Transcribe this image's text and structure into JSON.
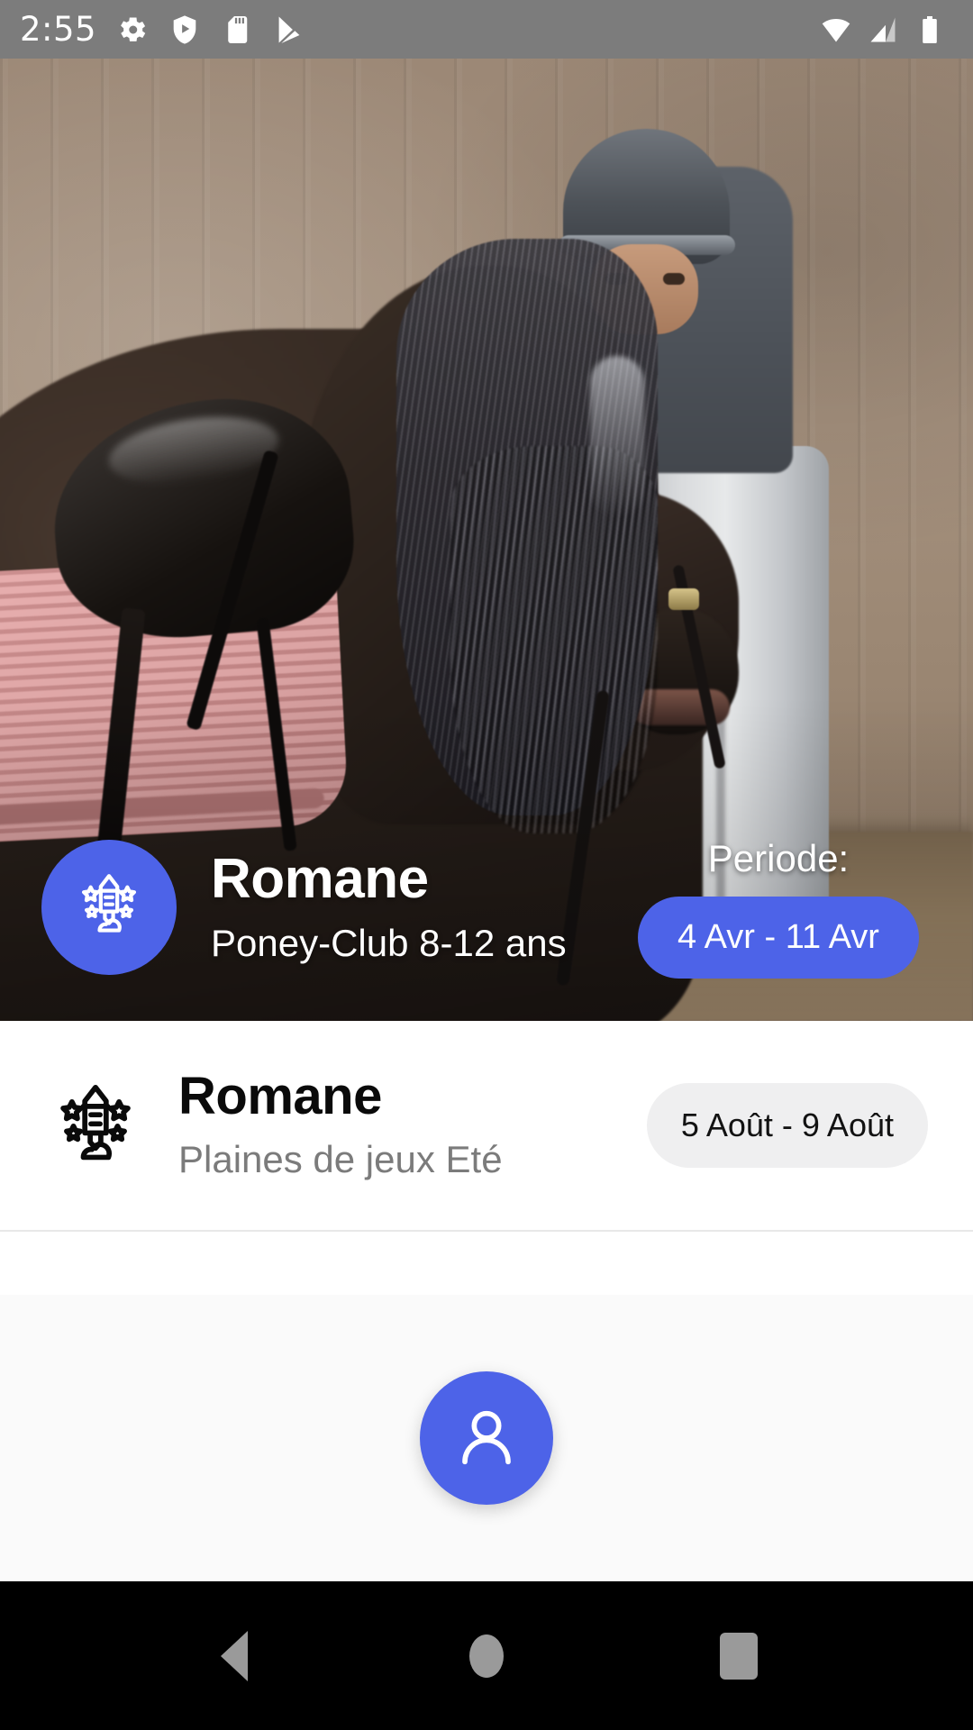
{
  "status_bar": {
    "clock": "2:55",
    "left_icons": [
      "gear-icon",
      "play-protect-shield-icon",
      "sd-card-icon",
      "play-store-icon"
    ],
    "right_icons": [
      "wifi-icon",
      "cellular-signal-icon",
      "battery-icon"
    ],
    "background_color": "#7c7c7c"
  },
  "hero": {
    "badge_icon": "rocket-launch-stars-icon",
    "title": "Romane",
    "subtitle": "Poney-Club 8-12 ans",
    "period_label": "Periode:",
    "period_value": "4 Avr - 11 Avr",
    "accent_color": "#4d63e8"
  },
  "list": {
    "items": [
      {
        "icon": "rocket-launch-stars-icon",
        "title": "Romane",
        "subtitle": "Plaines de jeux Eté",
        "period": "5 Août - 9 Août"
      }
    ]
  },
  "fab": {
    "icon": "person-icon",
    "color": "#4d63e8"
  },
  "nav_bar": {
    "back": "back-triangle-icon",
    "home": "home-circle-icon",
    "recents": "recents-square-icon",
    "background_color": "#000000"
  }
}
